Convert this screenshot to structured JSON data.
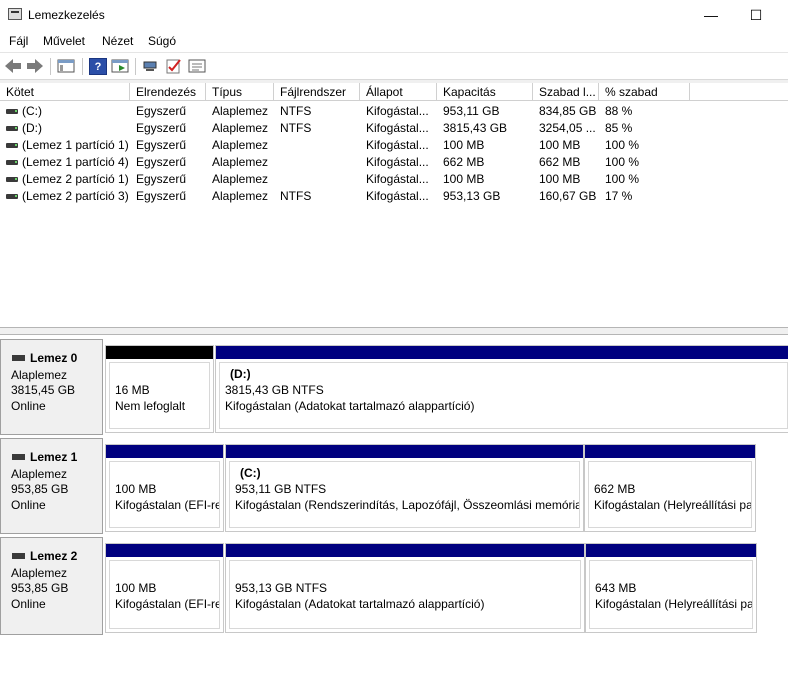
{
  "window": {
    "title": "Lemezkezelés",
    "minimize": "—",
    "maximize": "☐"
  },
  "menu": [
    "Fájl",
    "Művelet",
    "Nézet",
    "Súgó"
  ],
  "toolbar": {
    "icons": [
      "back-arrow-icon",
      "forward-arrow-icon",
      "show-hide-console-tree-icon",
      "help-icon",
      "action-pane-icon",
      "connect-icon",
      "check-icon",
      "properties-icon"
    ],
    "help_glyph": "?"
  },
  "columns": [
    "Kötet",
    "Elrendezés",
    "Típus",
    "Fájlrendszer",
    "Állapot",
    "Kapacitás",
    "Szabad l...",
    "% szabad"
  ],
  "volumes": [
    {
      "name": "(C:)",
      "layout": "Egyszerű",
      "type": "Alaplemez",
      "fs": "NTFS",
      "status": "Kifogástal...",
      "capacity": "953,11 GB",
      "free": "834,85 GB",
      "pct": "88 %"
    },
    {
      "name": "(D:)",
      "layout": "Egyszerű",
      "type": "Alaplemez",
      "fs": "NTFS",
      "status": "Kifogástal...",
      "capacity": "3815,43 GB",
      "free": "3254,05 ...",
      "pct": "85 %"
    },
    {
      "name": "(Lemez 1 partíció 1)",
      "layout": "Egyszerű",
      "type": "Alaplemez",
      "fs": "",
      "status": "Kifogástal...",
      "capacity": "100 MB",
      "free": "100 MB",
      "pct": "100 %"
    },
    {
      "name": "(Lemez 1 partíció 4)",
      "layout": "Egyszerű",
      "type": "Alaplemez",
      "fs": "",
      "status": "Kifogástal...",
      "capacity": "662 MB",
      "free": "662 MB",
      "pct": "100 %"
    },
    {
      "name": "(Lemez 2 partíció 1)",
      "layout": "Egyszerű",
      "type": "Alaplemez",
      "fs": "",
      "status": "Kifogástal...",
      "capacity": "100 MB",
      "free": "100 MB",
      "pct": "100 %"
    },
    {
      "name": "(Lemez 2 partíció 3)",
      "layout": "Egyszerű",
      "type": "Alaplemez",
      "fs": "NTFS",
      "status": "Kifogástal...",
      "capacity": "953,13 GB",
      "free": "160,67 GB",
      "pct": "17 %"
    }
  ],
  "colors": {
    "primary_partition": "#00007f",
    "unallocated": "#000000",
    "background": "#f0f0f0"
  },
  "disks": [
    {
      "name": "Lemez 0",
      "type": "Alaplemez",
      "size": "3815,45 GB",
      "status": "Online",
      "partitions": [
        {
          "label": "",
          "size": "16 MB",
          "status": "Nem lefoglalt",
          "kind": "unallocated"
        },
        {
          "label": "(D:)",
          "size": "3815,43 GB NTFS",
          "status": "Kifogástalan (Adatokat tartalmazó alappartíció)",
          "kind": "primary"
        }
      ]
    },
    {
      "name": "Lemez 1",
      "type": "Alaplemez",
      "size": "953,85 GB",
      "status": "Online",
      "partitions": [
        {
          "label": "",
          "size": "100 MB",
          "status": "Kifogástalan (EFI-rendszerpartíció)",
          "kind": "primary"
        },
        {
          "label": "(C:)",
          "size": "953,11 GB NTFS",
          "status": "Kifogástalan (Rendszerindítás, Lapozófájl, Összeomlási memóriakép, Alappartíció)",
          "kind": "primary"
        },
        {
          "label": "",
          "size": "662 MB",
          "status": "Kifogástalan (Helyreállítási partíció)",
          "kind": "primary"
        }
      ]
    },
    {
      "name": "Lemez 2",
      "type": "Alaplemez",
      "size": "953,85 GB",
      "status": "Online",
      "partitions": [
        {
          "label": "",
          "size": "100 MB",
          "status": "Kifogástalan (EFI-rendszerpartíció)",
          "kind": "primary"
        },
        {
          "label": "",
          "size": "953,13 GB NTFS",
          "status": "Kifogástalan (Adatokat tartalmazó alappartíció)",
          "kind": "primary"
        },
        {
          "label": "",
          "size": "643 MB",
          "status": "Kifogástalan (Helyreállítási partíció)",
          "kind": "primary"
        }
      ]
    }
  ]
}
